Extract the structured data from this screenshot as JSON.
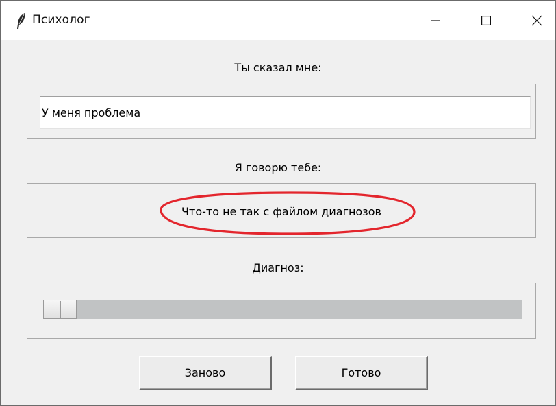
{
  "window": {
    "title": "Психолог",
    "icon": "feather-icon",
    "controls": [
      "minimize-icon",
      "maximize-icon",
      "close-icon"
    ]
  },
  "you_said": {
    "label": "Ты сказал мне:",
    "value": "У меня проблема"
  },
  "i_say": {
    "label": "Я говорю тебе:",
    "text": "Что-то не так с файлом диагнозов",
    "highlight_color": "#e3262d"
  },
  "diagnosis": {
    "label": "Диагноз:",
    "progress": 0.07
  },
  "buttons": {
    "reset_label": "Заново",
    "done_label": "Готово"
  }
}
